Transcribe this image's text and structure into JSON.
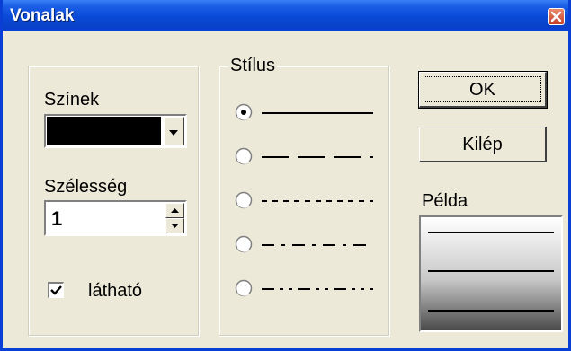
{
  "window": {
    "title": "Vonalak"
  },
  "colors_group": {
    "colors_label": "Színek",
    "selected_color": "#000000",
    "width_label": "Szélesség",
    "width_value": "1",
    "visible_label": "látható",
    "visible_checked": true
  },
  "style_group": {
    "legend": "Stílus",
    "options": [
      {
        "name": "solid",
        "dash": "",
        "selected": true
      },
      {
        "name": "dash",
        "dash": "30,10",
        "selected": false
      },
      {
        "name": "dot",
        "dash": "6,6",
        "selected": false
      },
      {
        "name": "dash-dot",
        "dash": "14,8,4,8",
        "selected": false
      },
      {
        "name": "dash-dot-dot",
        "dash": "14,6,4,6,4,6",
        "selected": false
      }
    ]
  },
  "buttons": {
    "ok": "OK",
    "exit": "Kilép"
  },
  "preview": {
    "label": "Példa"
  },
  "palette": {
    "title_bar": "#0a4ad8",
    "close_button": "#c4412a",
    "dialog_bg": "#ece9d8"
  }
}
